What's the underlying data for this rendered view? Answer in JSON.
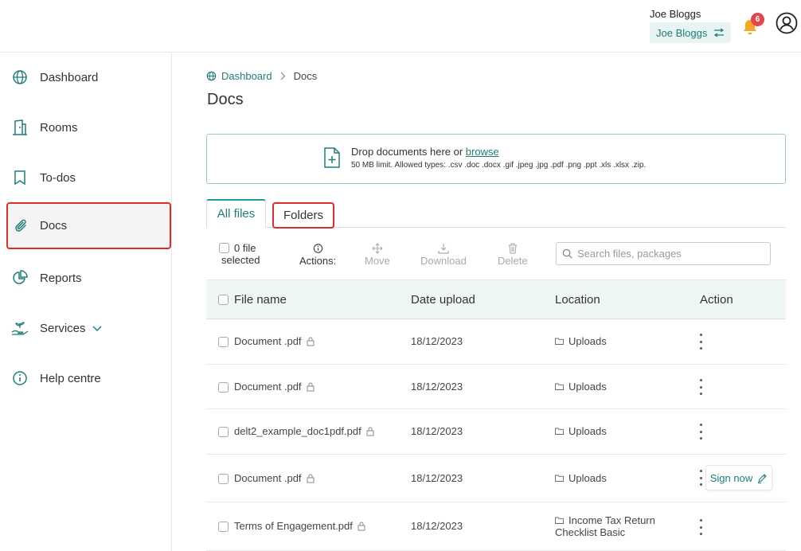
{
  "header": {
    "user_name": "Joe Bloggs",
    "account_switch": "Joe Bloggs",
    "notification_count": "6"
  },
  "sidebar": {
    "items": [
      {
        "label": "Dashboard",
        "icon": "globe-icon"
      },
      {
        "label": "Rooms",
        "icon": "building-icon"
      },
      {
        "label": "To-dos",
        "icon": "bookmark-icon"
      },
      {
        "label": "Docs",
        "icon": "paperclip-icon"
      },
      {
        "label": "Reports",
        "icon": "pie-chart-icon"
      },
      {
        "label": "Services",
        "icon": "hand-plant-icon"
      },
      {
        "label": "Help centre",
        "icon": "info-icon"
      }
    ]
  },
  "breadcrumb": {
    "home": "Dashboard",
    "current": "Docs"
  },
  "page_title": "Docs",
  "dropzone": {
    "text": "Drop documents here or ",
    "browse": "browse",
    "limits": "50 MB limit. Allowed types: .csv .doc .docx .gif .jpeg .jpg .pdf .png .ppt .xls .xlsx .zip."
  },
  "tabs": {
    "all_files": "All files",
    "folders": "Folders"
  },
  "toolbar": {
    "selected_count": "0 file",
    "selected_label": "selected",
    "actions": "Actions:",
    "move": "Move",
    "download": "Download",
    "delete": "Delete",
    "search_placeholder": "Search files, packages"
  },
  "table": {
    "headers": {
      "file_name": "File name",
      "date_upload": "Date upload",
      "location": "Location",
      "action": "Action"
    },
    "rows": [
      {
        "file": "Document .pdf",
        "date": "18/12/2023",
        "location": "Uploads",
        "location2": ""
      },
      {
        "file": "Document .pdf",
        "date": "18/12/2023",
        "location": "Uploads",
        "location2": ""
      },
      {
        "file": "delt2_example_doc1pdf.pdf",
        "date": "18/12/2023",
        "location": "Uploads",
        "location2": ""
      },
      {
        "file": "Document .pdf",
        "date": "18/12/2023",
        "location": "Uploads",
        "location2": "",
        "sign": "Sign now"
      },
      {
        "file": "Terms of Engagement.pdf",
        "date": "18/12/2023",
        "location": "Income Tax Return",
        "location2": "Checklist Basic"
      }
    ]
  },
  "colors": {
    "accent": "#1f7d7a",
    "highlight": "#e02b2b",
    "badge": "#e0474c",
    "bell": "#f5a623"
  }
}
